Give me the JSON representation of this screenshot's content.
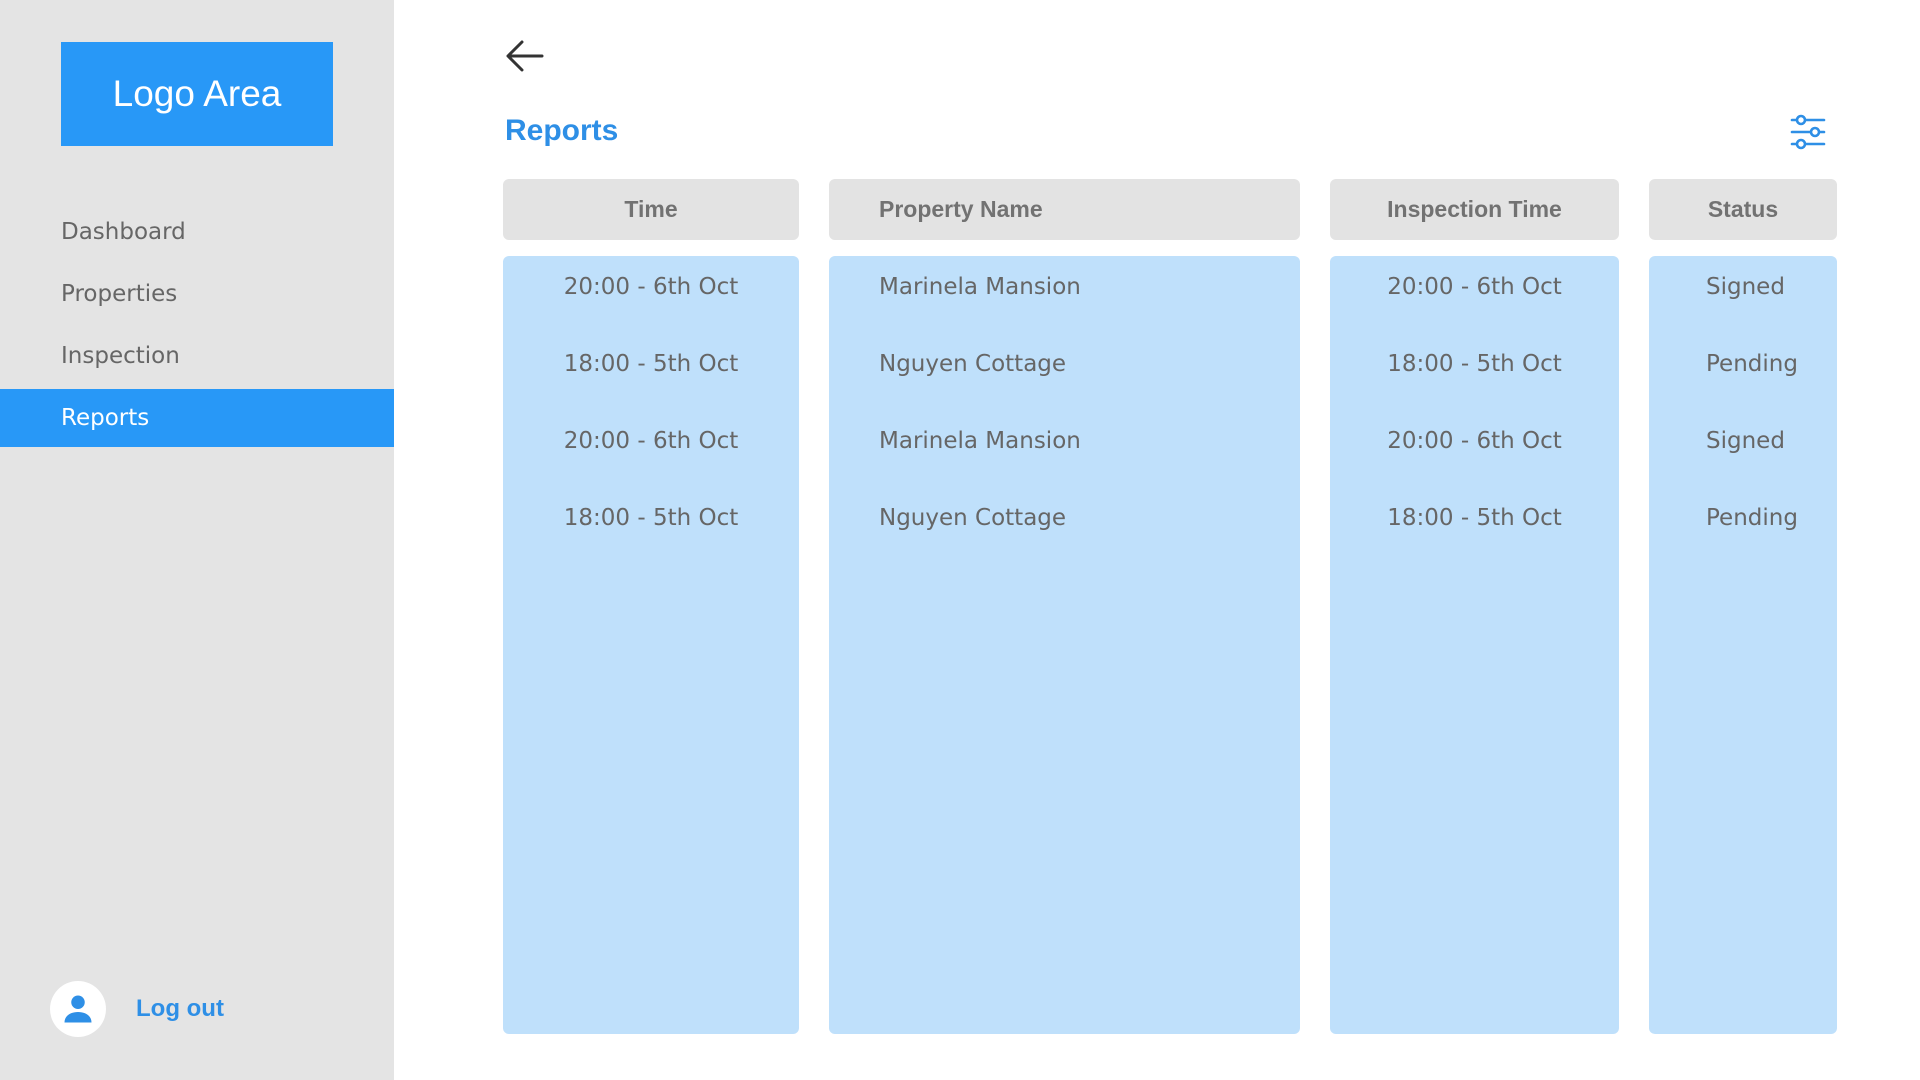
{
  "sidebar": {
    "logo": "Logo Area",
    "items": [
      {
        "label": "Dashboard",
        "active": false
      },
      {
        "label": "Properties",
        "active": false
      },
      {
        "label": "Inspection",
        "active": false
      },
      {
        "label": "Reports",
        "active": true
      }
    ],
    "logout_label": "Log out"
  },
  "header": {
    "title": "Reports",
    "back_icon": "arrow-left-icon",
    "filter_icon": "sliders-icon"
  },
  "table": {
    "columns": [
      "Time",
      "Property Name",
      "Inspection Time",
      "Status"
    ],
    "rows": [
      {
        "time": "20:00 - 6th Oct",
        "property": "Marinela Mansion",
        "inspection": "20:00 - 6th Oct",
        "status": "Signed"
      },
      {
        "time": "18:00 - 5th Oct",
        "property": "Nguyen Cottage",
        "inspection": "18:00 - 5th Oct",
        "status": "Pending"
      },
      {
        "time": "20:00 - 6th Oct",
        "property": "Marinela Mansion",
        "inspection": "20:00 - 6th Oct",
        "status": "Signed"
      },
      {
        "time": "18:00 - 5th Oct",
        "property": "Nguyen Cottage",
        "inspection": "18:00 - 5th Oct",
        "status": "Pending"
      }
    ]
  },
  "colors": {
    "accent": "#2898f7",
    "sidebar_bg": "#e4e4e4",
    "column_bg": "#bfe0fb",
    "header_bg": "#e3e3e3"
  }
}
